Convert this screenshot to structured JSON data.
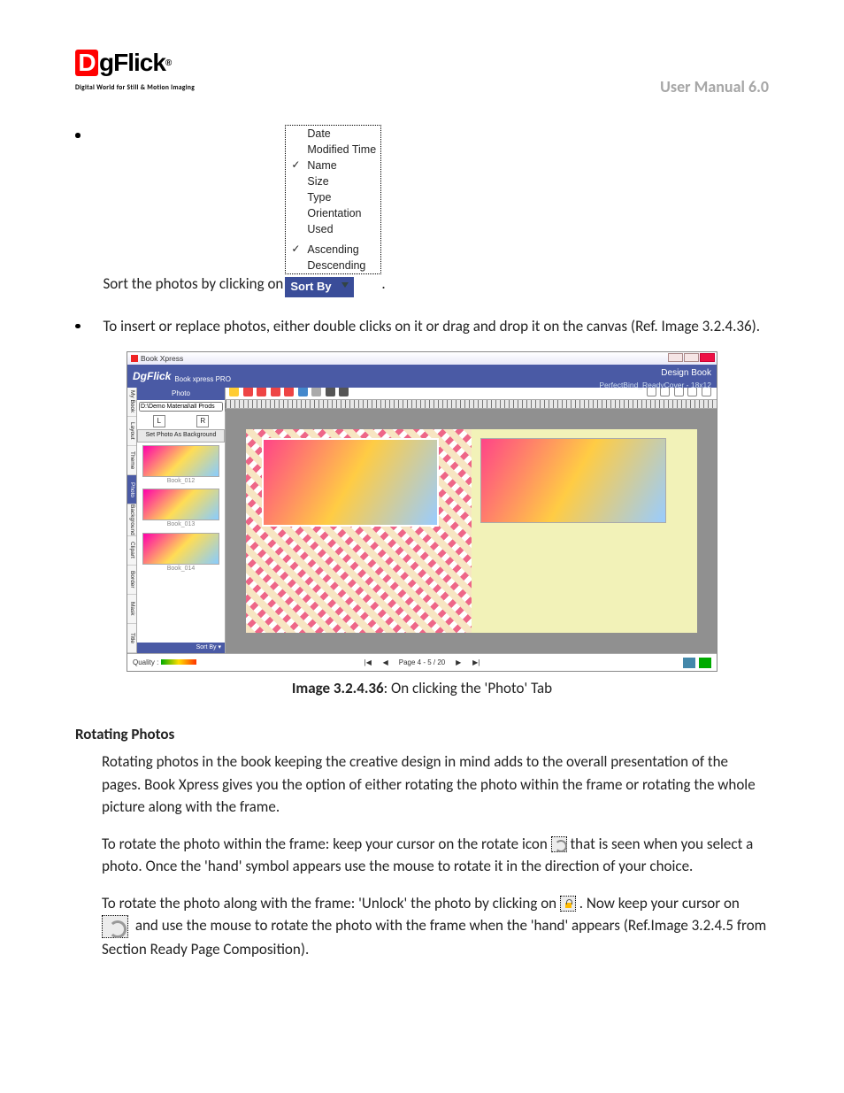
{
  "header": {
    "logo_word": "gFlick",
    "logo_tag": "Digital World for Still & Motion Imaging",
    "manual_title": "User Manual 6.0"
  },
  "sort_menu": {
    "items": [
      "Date",
      "Modified Time",
      "Name",
      "Size",
      "Type",
      "Orientation",
      "Used"
    ],
    "checked_item_index": 2,
    "order": [
      "Ascending",
      "Descending"
    ],
    "checked_order_index": 0,
    "button_label": "Sort By"
  },
  "bullets": {
    "sort_text": "Sort the photos by clicking on",
    "insert_text": "To insert or replace photos, either double clicks on it or drag and drop it on the canvas (Ref. Image 3.2.4.36)."
  },
  "screenshot": {
    "window_title": "Book Xpress",
    "brand": "DgFlick",
    "subbrand": "Book xpress PRO",
    "design_label": "Design Book",
    "cover_label": "PerfectBind_ReadyCover - 18x12",
    "side_tab": "Photo",
    "path_value": "D:\\Demo Material\\all Prods",
    "set_bg": "Set Photo As Background",
    "lr": {
      "l": "L",
      "r": "R"
    },
    "thumbs": [
      "Book_012",
      "Book_013",
      "Book_014"
    ],
    "side_sort": "Sort By ▾",
    "vtabs": [
      "My Book",
      "Layout",
      "Theme",
      "Photo",
      "Background",
      "Clipart",
      "Border",
      "Mask",
      "Title"
    ],
    "vtab_selected_index": 3,
    "footer_quality": "Quality :",
    "footer_page": "Page 4 - 5 / 20",
    "nav": {
      "first": "|◀",
      "prev": "◀",
      "next": "▶",
      "last": "▶|"
    }
  },
  "caption": {
    "bold": "Image 3.2.4.36",
    "rest": ": On clicking the 'Photo' Tab"
  },
  "rotating": {
    "heading": "Rotating Photos",
    "p1": "Rotating photos in the book keeping the creative design in mind adds to the overall presentation of the pages. Book Xpress gives you the option of either rotating the photo within the frame or rotating the whole picture along with the frame.",
    "p2a": "To rotate the photo within the frame: keep your cursor on the rotate icon ",
    "p2b": " that is seen when you select a photo. Once the 'hand' symbol appears use the mouse to rotate it in the direction of your choice.",
    "p3a": "To rotate the photo along with the frame: 'Unlock' the photo by clicking on ",
    "p3b": ". Now keep your cursor on ",
    "p3c": " and use the mouse to rotate the photo with the frame when the 'hand' appears (Ref.Image 3.2.4.5 from Section Ready Page Composition)."
  }
}
